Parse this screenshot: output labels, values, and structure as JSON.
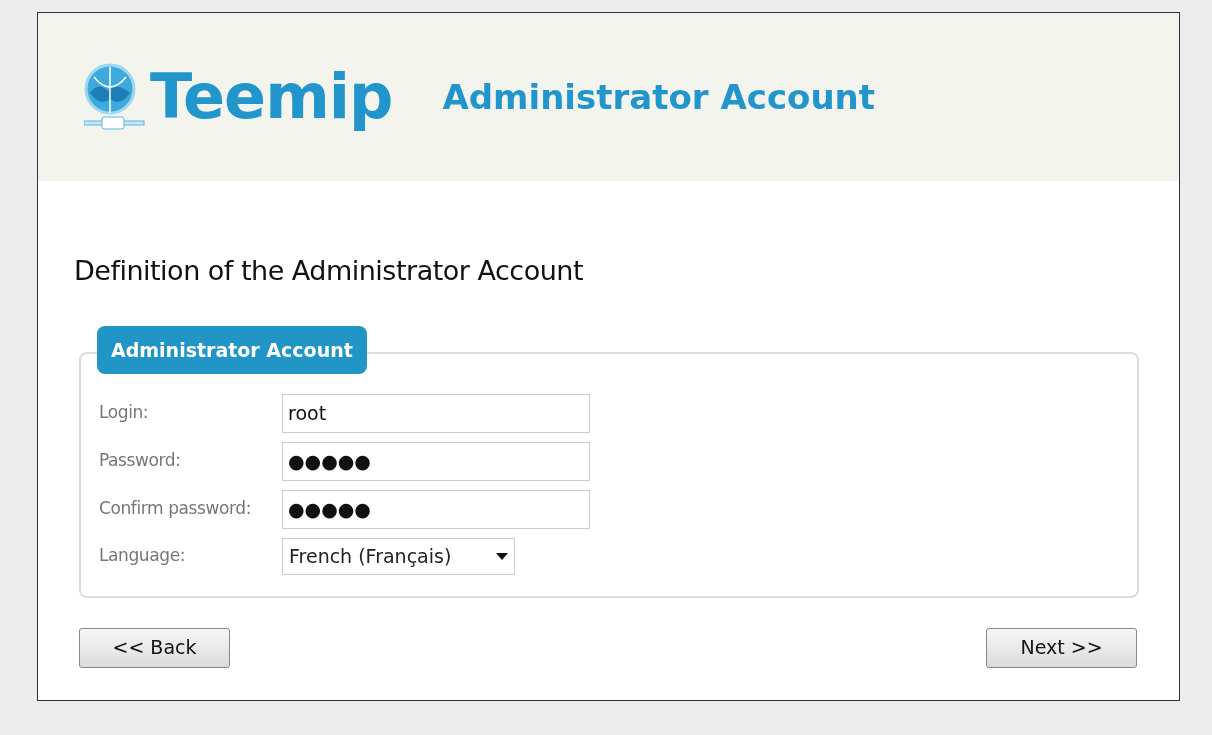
{
  "header": {
    "logo_text": "Teemip",
    "title": "Administrator Account"
  },
  "page_title": "Definition of the Administrator Account",
  "fieldset": {
    "legend": "Administrator Account",
    "fields": [
      {
        "kind": "text",
        "label": "Login:",
        "value": "root"
      },
      {
        "kind": "text",
        "label": "Password:",
        "value": "●●●●●"
      },
      {
        "kind": "text",
        "label": "Confirm password:",
        "value": "●●●●●"
      },
      {
        "kind": "select",
        "label": "Language:",
        "value": "French (Français)"
      }
    ]
  },
  "buttons": {
    "back": "<< Back",
    "next": "Next >>"
  }
}
